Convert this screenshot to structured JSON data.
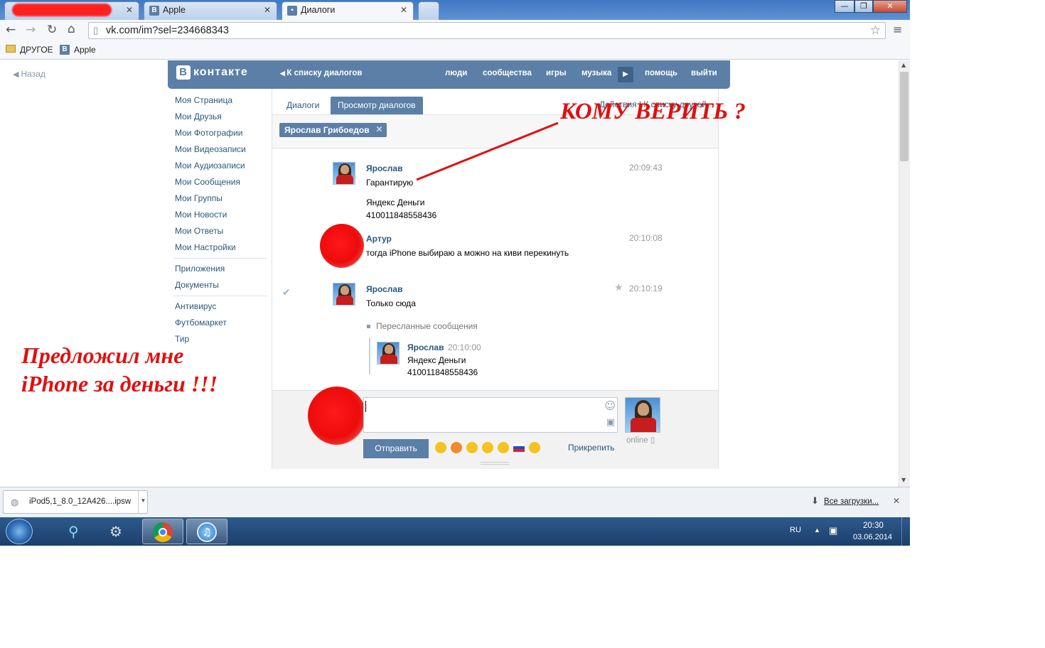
{
  "browser": {
    "tabs": [
      {
        "label": ""
      },
      {
        "label": "Apple"
      },
      {
        "label": "Диалоги"
      }
    ],
    "url": "vk.com/im?sel=234668343",
    "bookmarks": [
      {
        "label": "ДРУГОЕ"
      },
      {
        "label": "Apple"
      }
    ]
  },
  "vk": {
    "back": "Назад",
    "logo": "контакте",
    "logo_letter": "В",
    "back_to_list": "К списку диалогов",
    "nav": [
      "люди",
      "сообщества",
      "игры",
      "музыка",
      "помощь",
      "выйти"
    ],
    "left_menu": [
      "Моя Страница",
      "Мои Друзья",
      "Мои Фотографии",
      "Мои Видеозаписи",
      "Мои Аудиозаписи",
      "Мои Сообщения",
      "Мои Группы",
      "Мои Новости",
      "Мои Ответы",
      "Мои Настройки"
    ],
    "left_menu2": [
      "Приложения",
      "Документы"
    ],
    "left_menu3": [
      "Антивирус",
      "Футбомаркет",
      "Тир"
    ],
    "tabs": [
      "Диалоги",
      "Просмотр диалогов"
    ],
    "actions": "Действия | К списку друзей",
    "chip": "Ярослав Грибоедов",
    "messages": [
      {
        "author": "Ярослав",
        "time": "20:09:43",
        "lines": [
          "Гарантирую",
          "",
          "Яндекс Деньги",
          "410011848558436"
        ]
      },
      {
        "author": "Артур",
        "time": "20:10:08",
        "lines": [
          "тогда iPhone выбираю а можно на киви перекинуть"
        ]
      },
      {
        "author": "Ярослав",
        "time": "20:10:19",
        "lines": [
          "Только сюда"
        ]
      }
    ],
    "forwarded_label": "Пересланные сообщения",
    "forwarded": {
      "author": "Ярослав",
      "time": "20:10:00",
      "lines": [
        "Яндекс Деньги",
        "410011848558436"
      ]
    },
    "send": "Отправить",
    "attach": "Прикрепить",
    "online": "online"
  },
  "download": {
    "file": "iPod5,1_8.0_12A426....ipsw",
    "all": "Все загрузки..."
  },
  "taskbar": {
    "lang": "RU",
    "time": "20:30",
    "date": "03.06.2014"
  },
  "annotations": {
    "top": "КОМУ ВЕРИТЬ ?",
    "left_line1": "Предложил мне",
    "left_line2": "iPhone за деньги !!!"
  },
  "colors": {
    "vk_blue": "#5b7fa6",
    "link": "#2b587a",
    "annotation": "#e01010"
  }
}
